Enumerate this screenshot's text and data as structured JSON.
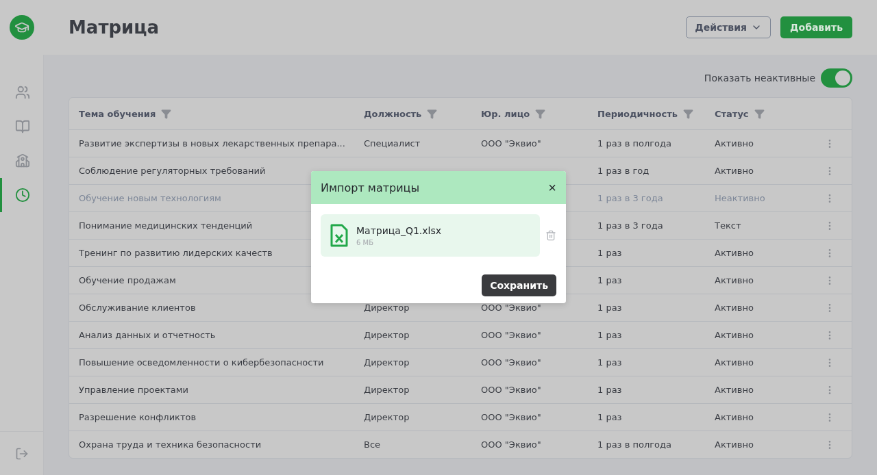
{
  "header": {
    "title": "Матрица",
    "actions_button": "Действия",
    "add_button": "Добавить"
  },
  "sidebar": {
    "items": [
      {
        "kind": "users",
        "selected": false
      },
      {
        "kind": "book",
        "selected": false
      },
      {
        "kind": "building",
        "selected": false
      },
      {
        "kind": "clock",
        "selected": true
      }
    ]
  },
  "toggle": {
    "label": "Показать неактивные",
    "on": true
  },
  "table": {
    "columns": [
      "Тема обучения",
      "Должность",
      "Юр. лицо",
      "Периодичность",
      "Статус"
    ],
    "rows": [
      {
        "topic": "Развитие экспертизы в новых лекарственных препара...",
        "position": "Специалист",
        "entity": "ООО \"Эквио\"",
        "period": "1 раз в полгода",
        "status": "Активно",
        "inactive": false
      },
      {
        "topic": "Соблюдение регуляторных требований",
        "period": "1 раз в год",
        "status": "Активно",
        "inactive": false
      },
      {
        "topic": "Обучение новым технологиям",
        "period": "1 раз в 3 года",
        "status": "Неактивно",
        "inactive": true
      },
      {
        "topic": "Понимание медицинских тенденций",
        "period": "1 раз в 3 года",
        "status": "Текст",
        "inactive": false
      },
      {
        "topic": "Тренинг по развитию лидерских качеств",
        "period": "1 раз",
        "status": "Активно",
        "inactive": false
      },
      {
        "topic": "Обучение продажам",
        "period": "1 раз",
        "status": "Активно",
        "inactive": false
      },
      {
        "topic": "Обслуживание клиентов",
        "position": "Директор",
        "entity": "ООО \"Эквио\"",
        "period": "1 раз",
        "status": "Активно",
        "inactive": false
      },
      {
        "topic": "Анализ данных и отчетность",
        "position": "Директор",
        "entity": "ООО \"Эквио\"",
        "period": "1 раз",
        "status": "Активно",
        "inactive": false
      },
      {
        "topic": "Повышение осведомленности о кибербезопасности",
        "position": "Директор",
        "entity": "ООО \"Эквио\"",
        "period": "1 раз",
        "status": "Активно",
        "inactive": false
      },
      {
        "topic": "Управление проектами",
        "position": "Директор",
        "entity": "ООО \"Эквио\"",
        "period": "1 раз",
        "status": "Активно",
        "inactive": false
      },
      {
        "topic": "Разрешение конфликтов",
        "position": "Директор",
        "entity": "ООО \"Эквио\"",
        "period": "1 раз",
        "status": "Активно",
        "inactive": false
      },
      {
        "topic": "Охрана труда и техника безопасности",
        "position": "Все",
        "entity": "ООО \"Эквио\"",
        "period": "1 раз в полгода",
        "status": "Активно",
        "inactive": false
      }
    ]
  },
  "dialog": {
    "title": "Импорт матрицы",
    "close": "×",
    "file": {
      "name": "Матрица_Q1.xlsx",
      "size": "6 МБ"
    },
    "save_button": "Сохранить"
  }
}
